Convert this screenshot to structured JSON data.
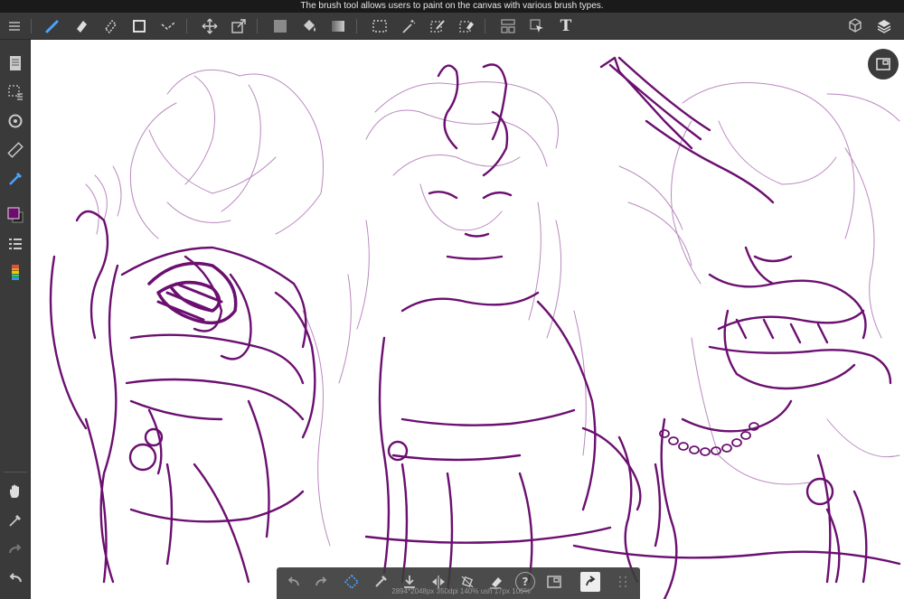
{
  "tooltip": {
    "text": "The brush tool allows users to paint on the canvas with various brush types."
  },
  "colors": {
    "toolbar_bg": "#3a3a3a",
    "accent": "#4aa3ff",
    "current_color": "#6e0b6e",
    "sketch_stroke": "#6b0f70",
    "sketch_light": "#b27db8"
  },
  "top_toolbar": {
    "icons": [
      "menu-icon",
      "brush-icon",
      "eraser-icon",
      "blur-icon",
      "shape-icon",
      "line-icon",
      "move-icon",
      "transform-icon",
      "fill-square-icon",
      "bucket-icon",
      "gradient-icon",
      "select-rect-icon",
      "magic-wand-icon",
      "select-pen-icon",
      "select-eraser-icon",
      "layout-icon",
      "select-cursor-icon",
      "text-icon",
      "3d-icon",
      "layers-icon"
    ],
    "text_tool_label": "T"
  },
  "left_sidebar": {
    "icons": [
      "layer-doc-icon",
      "selection-icon",
      "rotate-icon",
      "ruler-icon",
      "eyedropper-blue-icon",
      "color-swatch-icon",
      "layer-list-icon",
      "palette-icon",
      "hand-icon",
      "eyedropper-icon",
      "redo-icon",
      "undo-icon"
    ]
  },
  "bottom_toolbar": {
    "icons": [
      "undo-icon",
      "redo-icon",
      "transform-icon",
      "pen-icon",
      "download-icon",
      "flip-icon",
      "rotate-icon",
      "eraser-icon",
      "help-icon",
      "frame-icon",
      "share-icon",
      "grid-icon"
    ],
    "help_label": "?",
    "status_text": "2894*2048px 350dpi 140% ush 17px 100%"
  }
}
